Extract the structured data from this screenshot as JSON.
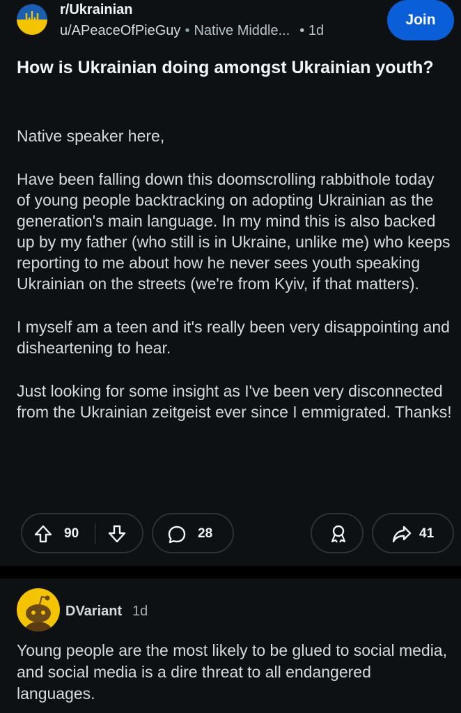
{
  "post": {
    "subreddit": "r/Ukrainian",
    "author": "u/APeaceOfPieGuy",
    "separator": "•",
    "flair": "Native Middle...",
    "age": "• 1d",
    "join_label": "Join",
    "title": "How is Ukrainian doing amongst Ukrainian youth?",
    "paragraphs": [
      "Native speaker here,",
      "Have been falling down this doomscrolling rabbithole today of young people backtracking on adopting Ukrainian as the generation's main language. In my mind this is also backed up by my father (who still is in Ukraine, unlike me) who keeps reporting to me about how he never sees youth speaking Ukrainian on the streets (we're from Kyiv, if that matters).",
      "I myself am a teen and it's really been very disappointing and disheartening to hear.",
      "Just looking for some insight as I've been very disconnected from the Ukrainian zeitgeist ever since I emmigrated. Thanks!"
    ],
    "score": "90",
    "comments": "28",
    "shares": "41"
  },
  "comment": {
    "user": "DVariant",
    "age": "1d",
    "text": "Young people are the most likely to be glued to social media, and social media is a dire threat to all endangered languages."
  },
  "colors": {
    "background": "#0e1113",
    "join_button": "#0a5ed7",
    "flag_blue": "#1b5fb5",
    "flag_yellow": "#f5c400"
  },
  "icons": {
    "subreddit_avatar": "ukraine-trident-icon",
    "upvote": "arrow-up-icon",
    "downvote": "arrow-down-icon",
    "comments": "speech-bubble-icon",
    "award": "award-icon",
    "share": "share-arrow-icon",
    "commenter_avatar": "snoo-avatar-icon"
  }
}
